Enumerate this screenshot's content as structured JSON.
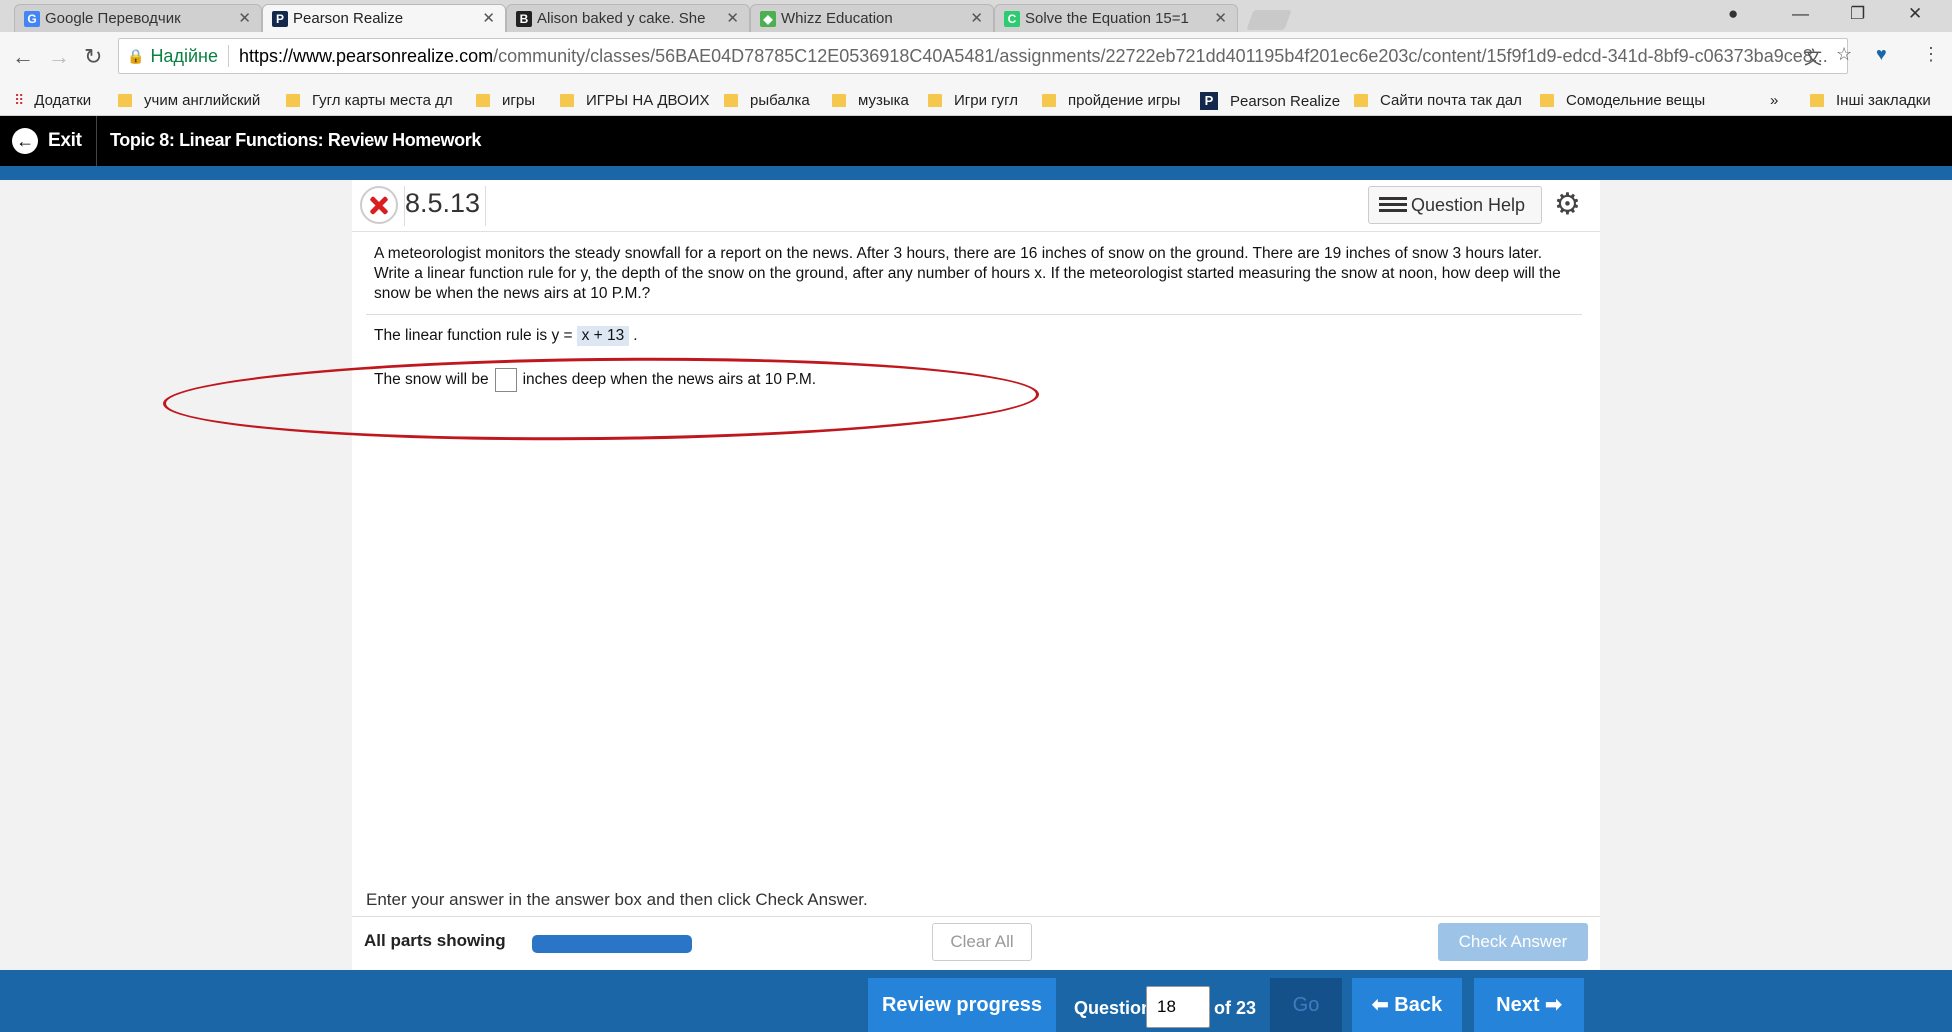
{
  "browser": {
    "tabs": [
      {
        "label": "Google Переводчик",
        "favicon": "google-translate-icon",
        "color": "#4285f4"
      },
      {
        "label": "Pearson Realize",
        "favicon": "pearson-icon",
        "color": "#13284b"
      },
      {
        "label": "Alison baked y cake. She",
        "favicon": "brainly-icon",
        "color": "#222222"
      },
      {
        "label": "Whizz Education",
        "favicon": "whizz-icon",
        "color": "#4caf50"
      },
      {
        "label": "Solve the Equation 15=1",
        "favicon": "mathway-icon",
        "color": "#2ecc71"
      }
    ],
    "secure_label": "Надійне",
    "url_host": "https://www.pearsonrealize.com",
    "url_path": "/community/classes/56BAE04D78785C12E0536918C40A5481/assignments/22722eb721dd401195b4f201ec6e203c/content/15f9f1d9-edcd-341d-8bf9-c06373ba9ce8...",
    "bookmarks": [
      {
        "label": "Додатки",
        "icon": "apps-icon"
      },
      {
        "label": "учим английский",
        "icon": "folder-icon"
      },
      {
        "label": "Гугл карты места дл",
        "icon": "folder-icon"
      },
      {
        "label": "игры",
        "icon": "folder-icon"
      },
      {
        "label": "ИГРЫ НА ДВОИХ",
        "icon": "folder-icon"
      },
      {
        "label": "рыбалка",
        "icon": "folder-icon"
      },
      {
        "label": "музыка",
        "icon": "folder-icon"
      },
      {
        "label": "Игри гугл",
        "icon": "folder-icon"
      },
      {
        "label": "пройдение игры",
        "icon": "folder-icon"
      },
      {
        "label": "Pearson Realize",
        "icon": "pearson-icon"
      },
      {
        "label": "Сайти почта так дал",
        "icon": "folder-icon"
      },
      {
        "label": "Сомодельние вещы",
        "icon": "folder-icon"
      },
      {
        "label": "Інші закладки",
        "icon": "folder-icon"
      }
    ],
    "bookmarks_overflow": "»"
  },
  "app": {
    "exit_label": "Exit",
    "title": "Topic 8: Linear Functions: Review Homework"
  },
  "question": {
    "number": "8.5.13",
    "help_label": "Question Help",
    "text": "A meteorologist monitors the steady snowfall for a report on the news. After 3 hours, there are 16 inches of snow on the ground. There are 19 inches of snow 3 hours later. Write a linear function rule for y, the depth of the snow on the ground, after any number of hours x. If the meteorologist started measuring the snow at noon, how deep will the snow be when the news airs at 10 P.M.?",
    "rule_prefix": "The linear function rule is y =",
    "rule_answer": "x + 13",
    "rule_suffix": ".",
    "snow_prefix": "The snow will be",
    "snow_suffix": "inches deep when the news airs at 10 P.M.",
    "snow_answer": "",
    "instruction": "Enter your answer in the answer box and then click Check Answer.",
    "parts_label": "All parts showing",
    "progress_fraction": 1.0,
    "clear_label": "Clear All",
    "check_label": "Check Answer"
  },
  "footer": {
    "review_label": "Review progress",
    "question_label": "Question",
    "question_value": "18",
    "of_label": "of 23",
    "go_label": "Go",
    "back_label": "Back",
    "next_label": "Next"
  },
  "colors": {
    "accent": "#1b66a7",
    "button": "#2584d9",
    "error": "#d81e1e",
    "annotation": "#c0161d"
  }
}
